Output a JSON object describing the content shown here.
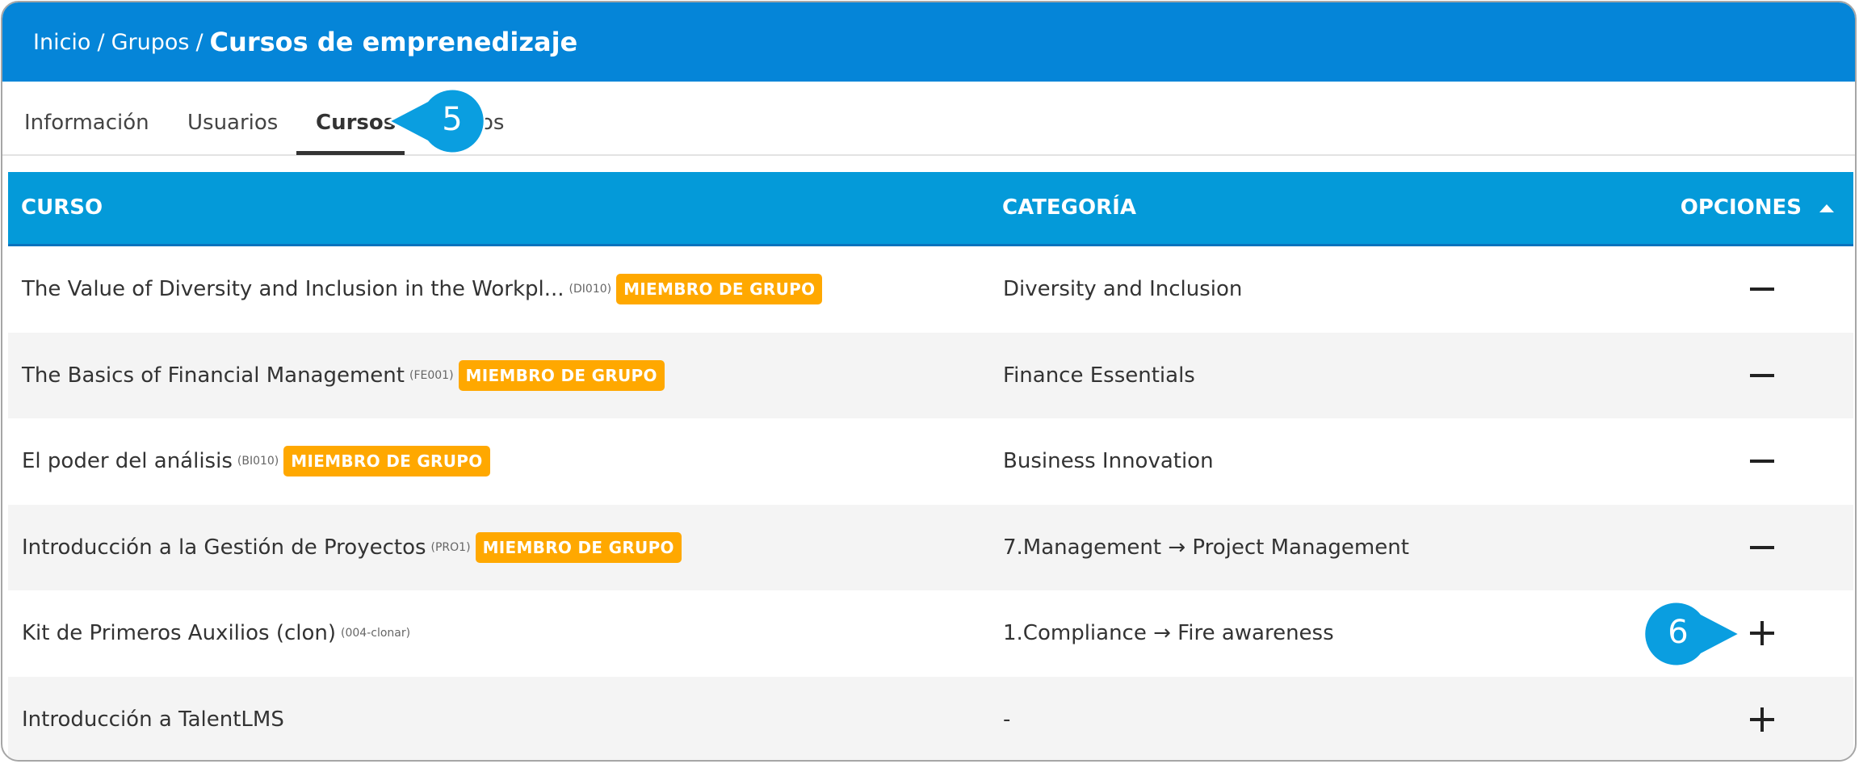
{
  "breadcrumb": {
    "home": "Inicio",
    "groups": "Grupos",
    "separator": "/",
    "current": "Cursos de emprenedizaje"
  },
  "tabs": [
    {
      "label": "Información",
      "active": false
    },
    {
      "label": "Usuarios",
      "active": false
    },
    {
      "label": "Cursos",
      "active": true
    },
    {
      "label": "os",
      "active": false
    }
  ],
  "table": {
    "headers": {
      "course": "CURSO",
      "category": "CATEGORÍA",
      "options": "OPCIONES"
    },
    "rows": [
      {
        "course": "The Value of Diversity and Inclusion in the Workpl...",
        "code": "(DI010)",
        "badge": "MIEMBRO DE GRUPO",
        "category": "Diversity and Inclusion",
        "action": "remove"
      },
      {
        "course": "The Basics of Financial Management",
        "code": "(FE001)",
        "badge": "MIEMBRO DE GRUPO",
        "category": "Finance Essentials",
        "action": "remove"
      },
      {
        "course": "El poder del análisis",
        "code": "(BI010)",
        "badge": "MIEMBRO DE GRUPO",
        "category": "Business Innovation",
        "action": "remove"
      },
      {
        "course": "Introducción a la Gestión de Proyectos",
        "code": "(PRO1)",
        "badge": "MIEMBRO DE GRUPO",
        "category": "7.Management → Project Management",
        "action": "remove"
      },
      {
        "course": "Kit de Primeros Auxilios (clon)",
        "code": "(004-clonar)",
        "badge": "",
        "category": "1.Compliance → Fire awareness",
        "action": "add"
      },
      {
        "course": "Introducción a TalentLMS",
        "code": "",
        "badge": "",
        "category": "-",
        "action": "add"
      }
    ]
  },
  "callouts": [
    {
      "number": "5",
      "target": "Cursos tab"
    },
    {
      "number": "6",
      "target": "add course button"
    }
  ],
  "colors": {
    "header_blue": "#0585d8",
    "table_header_blue": "#049ad9",
    "badge_orange": "#ffa800",
    "callout_blue": "#0a9ee0"
  }
}
